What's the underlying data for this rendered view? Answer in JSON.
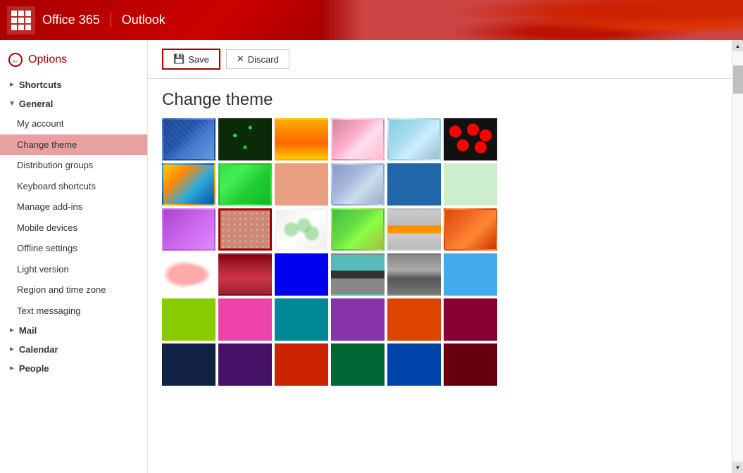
{
  "topbar": {
    "office365_label": "Office 365",
    "outlook_label": "Outlook"
  },
  "sidebar": {
    "options_label": "Options",
    "sections": [
      {
        "label": "Shortcuts",
        "expanded": false,
        "items": []
      },
      {
        "label": "General",
        "expanded": true,
        "items": [
          {
            "label": "My account",
            "active": false,
            "id": "my-account"
          },
          {
            "label": "Change theme",
            "active": true,
            "id": "change-theme"
          },
          {
            "label": "Distribution groups",
            "active": false,
            "id": "distribution-groups"
          },
          {
            "label": "Keyboard shortcuts",
            "active": false,
            "id": "keyboard-shortcuts"
          },
          {
            "label": "Manage add-ins",
            "active": false,
            "id": "manage-add-ins"
          },
          {
            "label": "Mobile devices",
            "active": false,
            "id": "mobile-devices"
          },
          {
            "label": "Offline settings",
            "active": false,
            "id": "offline-settings"
          },
          {
            "label": "Light version",
            "active": false,
            "id": "light-version"
          },
          {
            "label": "Region and time zone",
            "active": false,
            "id": "region-time-zone"
          },
          {
            "label": "Text messaging",
            "active": false,
            "id": "text-messaging"
          }
        ]
      },
      {
        "label": "Mail",
        "expanded": false,
        "items": []
      },
      {
        "label": "Calendar",
        "expanded": false,
        "items": []
      },
      {
        "label": "People",
        "expanded": false,
        "items": []
      }
    ]
  },
  "toolbar": {
    "save_label": "Save",
    "discard_label": "Discard"
  },
  "content": {
    "title": "Change theme"
  }
}
